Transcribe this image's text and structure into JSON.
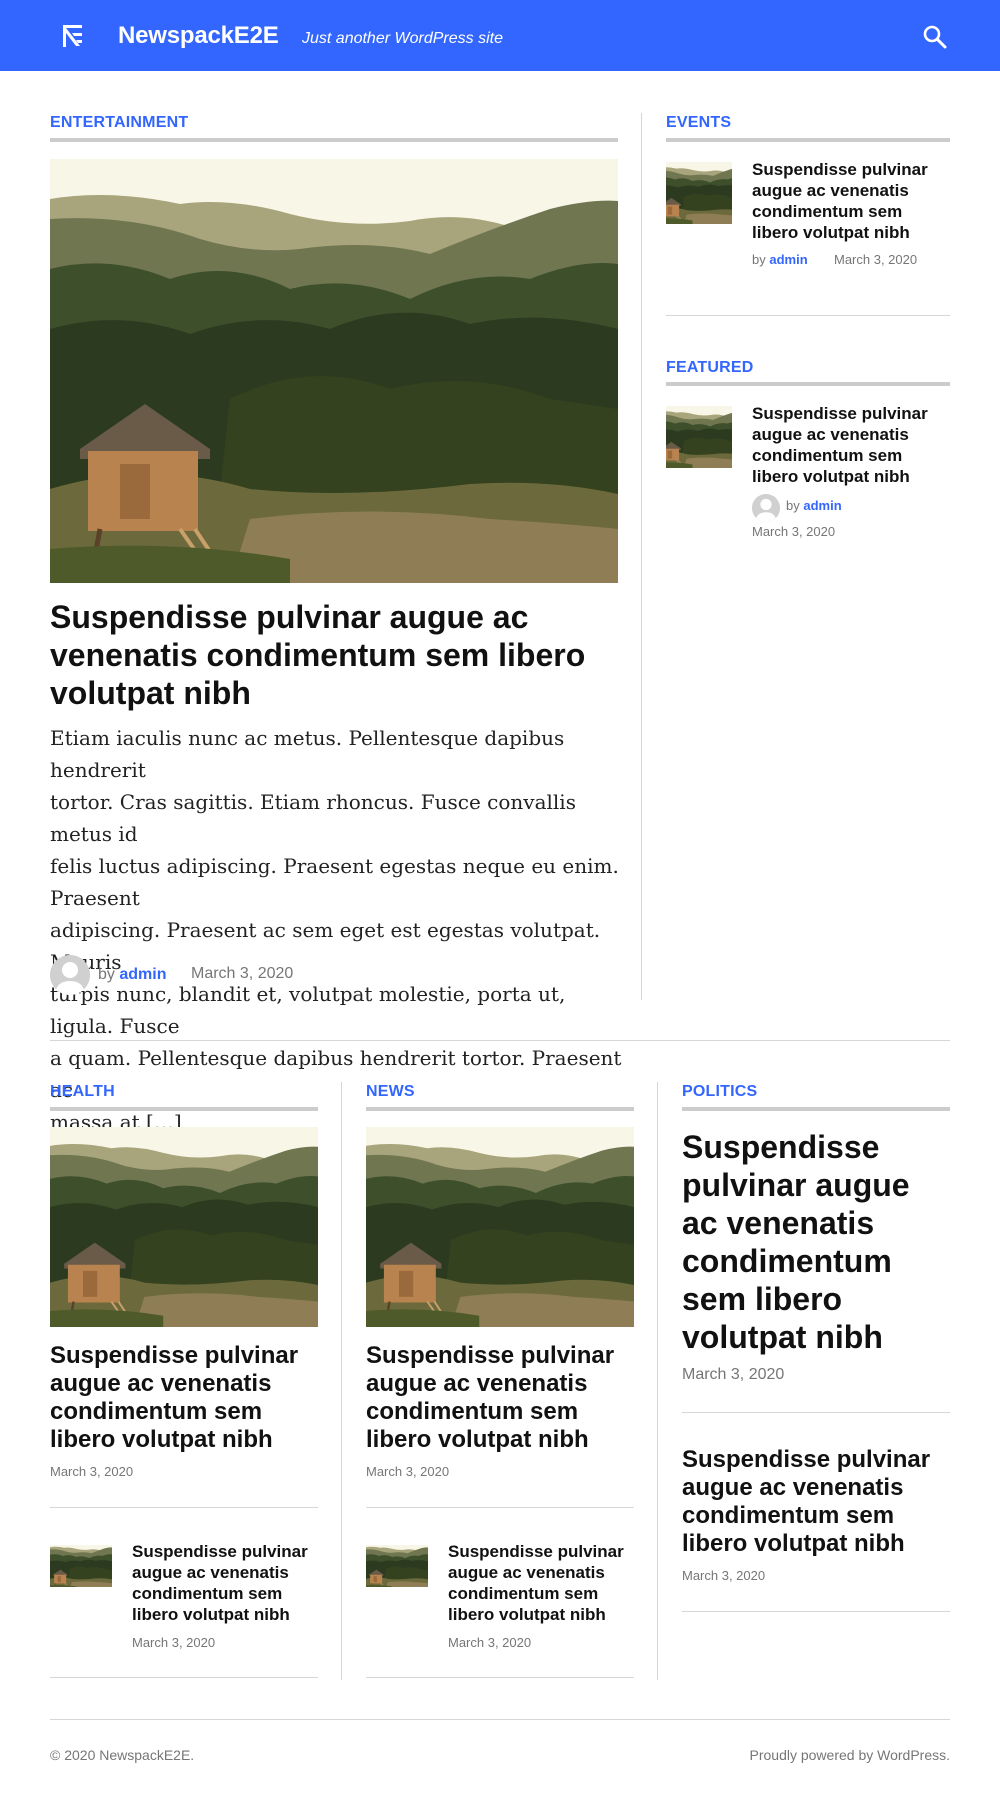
{
  "header": {
    "site_title": "NewspackE2E",
    "tagline": "Just another WordPress site",
    "search_icon": "search-icon",
    "logo_icon": "newspack-logo"
  },
  "colors": {
    "accent": "#3366ff",
    "rule": "#cccccc",
    "meta": "#767676"
  },
  "post": {
    "title": "Suspendisse pulvinar augue ac venenatis condimentum sem libero volutpat nibh",
    "date": "March 3, 2020",
    "by": "by",
    "author": "admin"
  },
  "entertainment": {
    "category": "ENTERTAINMENT",
    "title_lines": [
      "Suspendisse pulvinar augue ac",
      "venenatis condimentum sem libero",
      "volutpat nibh"
    ],
    "excerpt_lines": [
      "Etiam iaculis nunc ac metus. Pellentesque dapibus hendrerit",
      "tortor. Cras sagittis. Etiam rhoncus. Fusce convallis metus id",
      "felis luctus adipiscing. Praesent egestas neque eu enim. Praesent",
      "adipiscing. Praesent ac sem eget est egestas volutpat. Mauris",
      "turpis nunc, blandit et, volutpat molestie, porta ut, ligula. Fusce",
      "a quam. Pellentesque dapibus hendrerit tortor. Praesent ac",
      "massa at […]"
    ]
  },
  "events": {
    "category": "EVENTS"
  },
  "featured": {
    "category": "FEATURED"
  },
  "health": {
    "category": "HEALTH"
  },
  "news": {
    "category": "NEWS"
  },
  "politics": {
    "category": "POLITICS"
  },
  "footer": {
    "copyright": "© 2020 NewspackE2E.",
    "powered": "Proudly powered by WordPress."
  }
}
